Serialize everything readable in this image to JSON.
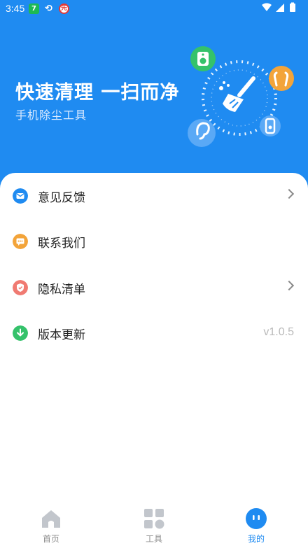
{
  "status": {
    "time": "3:45",
    "badge_seven": "7",
    "sync_glyph": "⟲",
    "red_badge": "先",
    "right_icons": "▾◢▮"
  },
  "hero": {
    "title": "快速清理 一扫而净",
    "subtitle": "手机除尘工具"
  },
  "menu": {
    "items": [
      {
        "label": "意见反馈",
        "icon": "mail-icon",
        "color": "#1f8bf1"
      },
      {
        "label": "联系我们",
        "icon": "message-icon",
        "color": "#f3a43a"
      },
      {
        "label": "隐私清单",
        "icon": "shield-icon",
        "color": "#f07a72"
      },
      {
        "label": "版本更新",
        "icon": "download-icon",
        "color": "#35c26b",
        "value": "v1.0.5"
      }
    ]
  },
  "tabbar": {
    "tabs": [
      {
        "label": "首页",
        "icon": "home-icon",
        "active": false
      },
      {
        "label": "工具",
        "icon": "grid-icon",
        "active": false
      },
      {
        "label": "我的",
        "icon": "face-icon",
        "active": true
      }
    ]
  },
  "colors": {
    "primary": "#1f8bf1",
    "header_bg": "#1f8bf1"
  }
}
